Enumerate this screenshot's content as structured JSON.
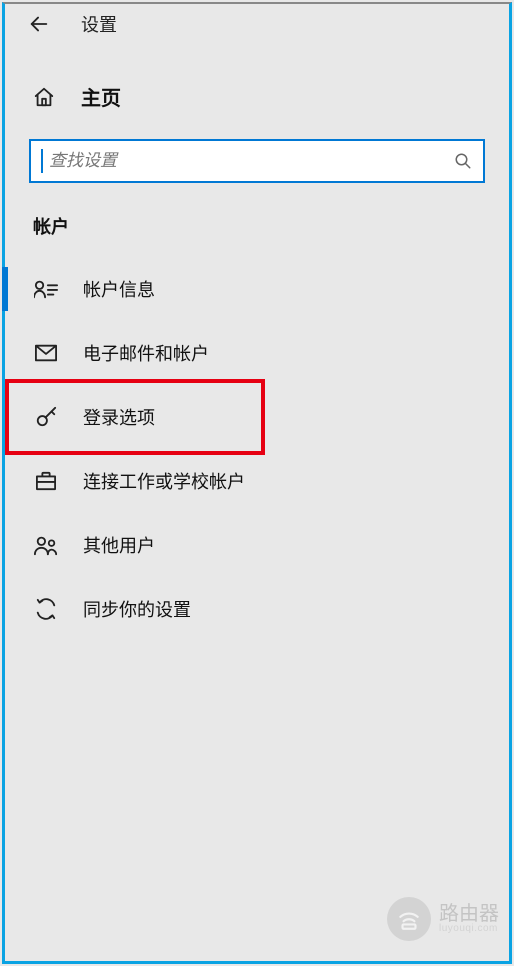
{
  "header": {
    "title": "设置"
  },
  "home": {
    "label": "主页"
  },
  "search": {
    "placeholder": "查找设置",
    "value": ""
  },
  "section": {
    "title": "帐户"
  },
  "nav": {
    "items": [
      {
        "id": "account-info",
        "label": "帐户信息",
        "icon": "user-badge-icon",
        "selected": true
      },
      {
        "id": "email",
        "label": "电子邮件和帐户",
        "icon": "mail-icon",
        "selected": false
      },
      {
        "id": "signin",
        "label": "登录选项",
        "icon": "key-icon",
        "selected": false,
        "highlighted": true
      },
      {
        "id": "work-school",
        "label": "连接工作或学校帐户",
        "icon": "briefcase-icon",
        "selected": false
      },
      {
        "id": "other-users",
        "label": "其他用户",
        "icon": "people-icon",
        "selected": false
      },
      {
        "id": "sync",
        "label": "同步你的设置",
        "icon": "sync-icon",
        "selected": false
      }
    ]
  },
  "watermark": {
    "main": "路由器",
    "sub": "luyouqi.com"
  }
}
